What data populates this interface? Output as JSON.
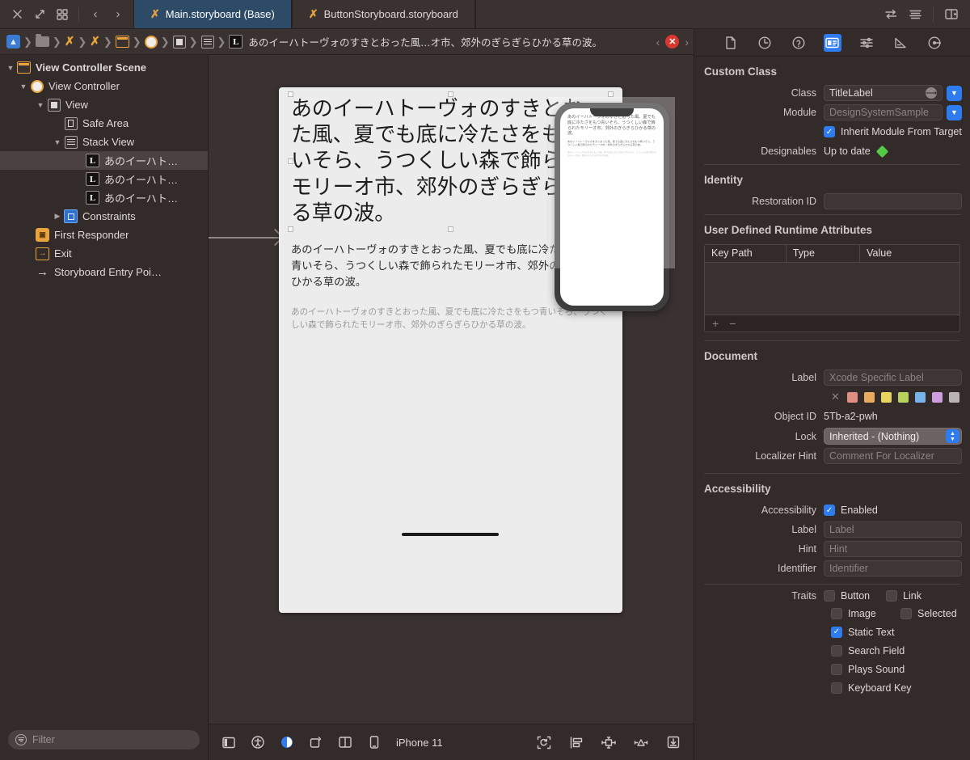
{
  "tabbar": {
    "left_icons": [
      "close-icon",
      "expand-icon",
      "grid-icon"
    ],
    "back_label": "‹",
    "forward_label": "›",
    "tabs": [
      {
        "label": "Main.storyboard (Base)",
        "active": true
      },
      {
        "label": "ButtonStoryboard.storyboard",
        "active": false
      }
    ],
    "right_icons": [
      "related-items-icon",
      "align-icon",
      "assistant-editor-icon"
    ]
  },
  "jumpbar": {
    "segments": [
      {
        "icon": "app-project-icon",
        "label": ""
      },
      {
        "icon": "folder-icon",
        "label": ""
      },
      {
        "icon": "storyboard-file-icon",
        "label": ""
      },
      {
        "icon": "storyboard-file-icon",
        "label": ""
      },
      {
        "icon": "view-controller-scene-icon",
        "label": ""
      },
      {
        "icon": "view-controller-icon",
        "label": ""
      },
      {
        "icon": "view-icon",
        "label": ""
      },
      {
        "icon": "stack-view-icon",
        "label": ""
      },
      {
        "icon": "label-icon",
        "label": ""
      }
    ],
    "title": "あのイーハトーヴォのすきとおった風…オ市、郊外のぎらぎらひかる草の波。",
    "prev_label": "‹",
    "next_label": "›",
    "error_badge": "✕"
  },
  "navigator": {
    "tree": [
      {
        "depth": 0,
        "twist": "▼",
        "icon": "view-controller-scene-icon",
        "label": "View Controller Scene",
        "selected": false,
        "bold": true
      },
      {
        "depth": 1,
        "twist": "▼",
        "icon": "view-controller-icon",
        "label": "View Controller",
        "selected": false,
        "bold": false
      },
      {
        "depth": 2,
        "twist": "▼",
        "icon": "view-icon",
        "label": "View",
        "selected": false,
        "bold": false
      },
      {
        "depth": 3,
        "twist": "",
        "icon": "safe-area-icon",
        "label": "Safe Area",
        "selected": false,
        "bold": false
      },
      {
        "depth": 3,
        "twist": "▼",
        "icon": "stack-view-icon",
        "label": "Stack View",
        "selected": false,
        "bold": false
      },
      {
        "depth": 4,
        "twist": "",
        "icon": "label-icon",
        "label": "あのイーハト…",
        "selected": true,
        "bold": false
      },
      {
        "depth": 4,
        "twist": "",
        "icon": "label-icon",
        "label": "あのイーハト…",
        "selected": false,
        "bold": false
      },
      {
        "depth": 4,
        "twist": "",
        "icon": "label-icon",
        "label": "あのイーハト…",
        "selected": false,
        "bold": false
      },
      {
        "depth": 3,
        "twist": "▶",
        "icon": "constraints-icon",
        "label": "Constraints",
        "selected": false,
        "bold": false
      },
      {
        "depth": 2,
        "twist": "",
        "icon": "first-responder-icon",
        "label": "First Responder",
        "selected": false,
        "bold": false
      },
      {
        "depth": 2,
        "twist": "",
        "icon": "exit-icon",
        "label": "Exit",
        "selected": false,
        "bold": false
      },
      {
        "depth": 2,
        "twist": "",
        "icon": "storyboard-entry-point-icon",
        "label": "Storyboard Entry Poi…",
        "selected": false,
        "bold": false
      }
    ],
    "filter_placeholder": "Filter"
  },
  "canvas": {
    "label_title": "あのイーハトーヴォのすきとおった風、夏でも底に冷たさをもつ青いそら、うつくしい森で飾られたモリーオ市、郊外のぎらぎらひかる草の波。",
    "label_body": "あのイーハトーヴォのすきとおった風、夏でも底に冷たさをもつ青いそら、うつくしい森で飾られたモリーオ市、郊外のぎらぎらひかる草の波。",
    "label_caption": "あのイーハトーヴォのすきとおった風、夏でも底に冷たさをもつ青いそら、うつくしい森で飾られたモリーオ市、郊外のぎらぎらひかる草の波。"
  },
  "canvasbar": {
    "device_label": "iPhone 11",
    "left_icons": [
      "show-hide-document-outline-icon",
      "accessibility-inspector-icon",
      "appearance-icon",
      "orientation-icon",
      "split-view-icon",
      "device-icon"
    ],
    "right_icons": [
      "update-frames-icon",
      "embed-in-icon",
      "align-icon",
      "add-constraints-icon",
      "resolve-auto-layout-issues-icon"
    ]
  },
  "inspector": {
    "toolbar_icons": [
      "file-inspector-icon",
      "history-inspector-icon",
      "quick-help-icon",
      "identity-inspector-icon",
      "attributes-inspector-icon",
      "size-inspector-icon",
      "connections-inspector-icon"
    ],
    "custom_class": {
      "title": "Custom Class",
      "class_label": "Class",
      "class_value": "TitleLabel",
      "module_label": "Module",
      "module_value": "DesignSystemSample",
      "inherit_label": "Inherit Module From Target",
      "inherit_checked": true,
      "designables_label": "Designables",
      "designables_value": "Up to date"
    },
    "identity": {
      "title": "Identity",
      "restoration_label": "Restoration ID",
      "restoration_value": ""
    },
    "runtime_attributes": {
      "title": "User Defined Runtime Attributes",
      "columns": [
        "Key Path",
        "Type",
        "Value"
      ],
      "rows": [],
      "add_label": "+",
      "remove_label": "−"
    },
    "document": {
      "title": "Document",
      "label_label": "Label",
      "label_placeholder": "Xcode Specific Label",
      "swatches": [
        "#e08d84",
        "#e8ab5e",
        "#e8d45e",
        "#b8d15e",
        "#78b3ea",
        "#cf9ce0",
        "#b9b3b1"
      ],
      "swatch_clear": "✕",
      "object_id_label": "Object ID",
      "object_id_value": "5Tb-a2-pwh",
      "lock_label": "Lock",
      "lock_value": "Inherited - (Nothing)",
      "localizer_label": "Localizer Hint",
      "localizer_placeholder": "Comment For Localizer"
    },
    "accessibility": {
      "title": "Accessibility",
      "accessibility_label": "Accessibility",
      "enabled_label": "Enabled",
      "enabled_checked": true,
      "label_label": "Label",
      "label_placeholder": "Label",
      "hint_label": "Hint",
      "hint_placeholder": "Hint",
      "identifier_label": "Identifier",
      "identifier_placeholder": "Identifier",
      "traits_label": "Traits",
      "traits": [
        {
          "label": "Button",
          "checked": false
        },
        {
          "label": "Link",
          "checked": false
        },
        {
          "label": "Image",
          "checked": false
        },
        {
          "label": "Selected",
          "checked": false
        },
        {
          "label": "Static Text",
          "checked": true
        },
        {
          "label": "Search Field",
          "checked": false
        },
        {
          "label": "Plays Sound",
          "checked": false
        },
        {
          "label": "Keyboard Key",
          "checked": false
        }
      ]
    }
  }
}
